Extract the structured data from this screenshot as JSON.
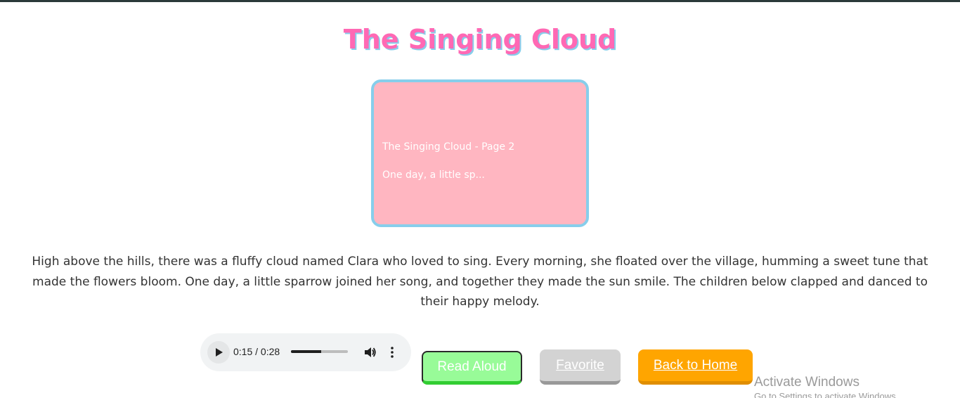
{
  "story": {
    "title": "The Singing Cloud",
    "page_image": {
      "caption": "The Singing Cloud - Page 2",
      "snippet": "One day, a little sp..."
    },
    "text": "High above the hills, there was a fluffy cloud named Clara who loved to sing. Every morning, she floated over the village, humming a sweet tune that made the flowers bloom. One day, a little sparrow joined her song, and together they made the sun smile. The children below clapped and danced to their happy melody."
  },
  "audio": {
    "time_display": "0:15 / 0:28",
    "progress_fraction": 0.536,
    "play_icon": "play-icon",
    "volume_icon": "volume-icon",
    "more_icon": "more-options-icon"
  },
  "buttons": {
    "read_aloud": "Read Aloud",
    "favorite": "Favorite",
    "back_home": "Back to Home"
  },
  "watermark": {
    "title": "Activate Windows",
    "subtitle": "Go to Settings to activate Windows."
  },
  "colors": {
    "title": "#ff69b4",
    "title_shadow": "#87ceeb",
    "image_bg": "#ffb6c1",
    "image_border": "#87ceeb",
    "read_aloud_bg": "#98fb98",
    "favorite_bg": "#d3d3d3",
    "home_bg": "#ffa500"
  }
}
